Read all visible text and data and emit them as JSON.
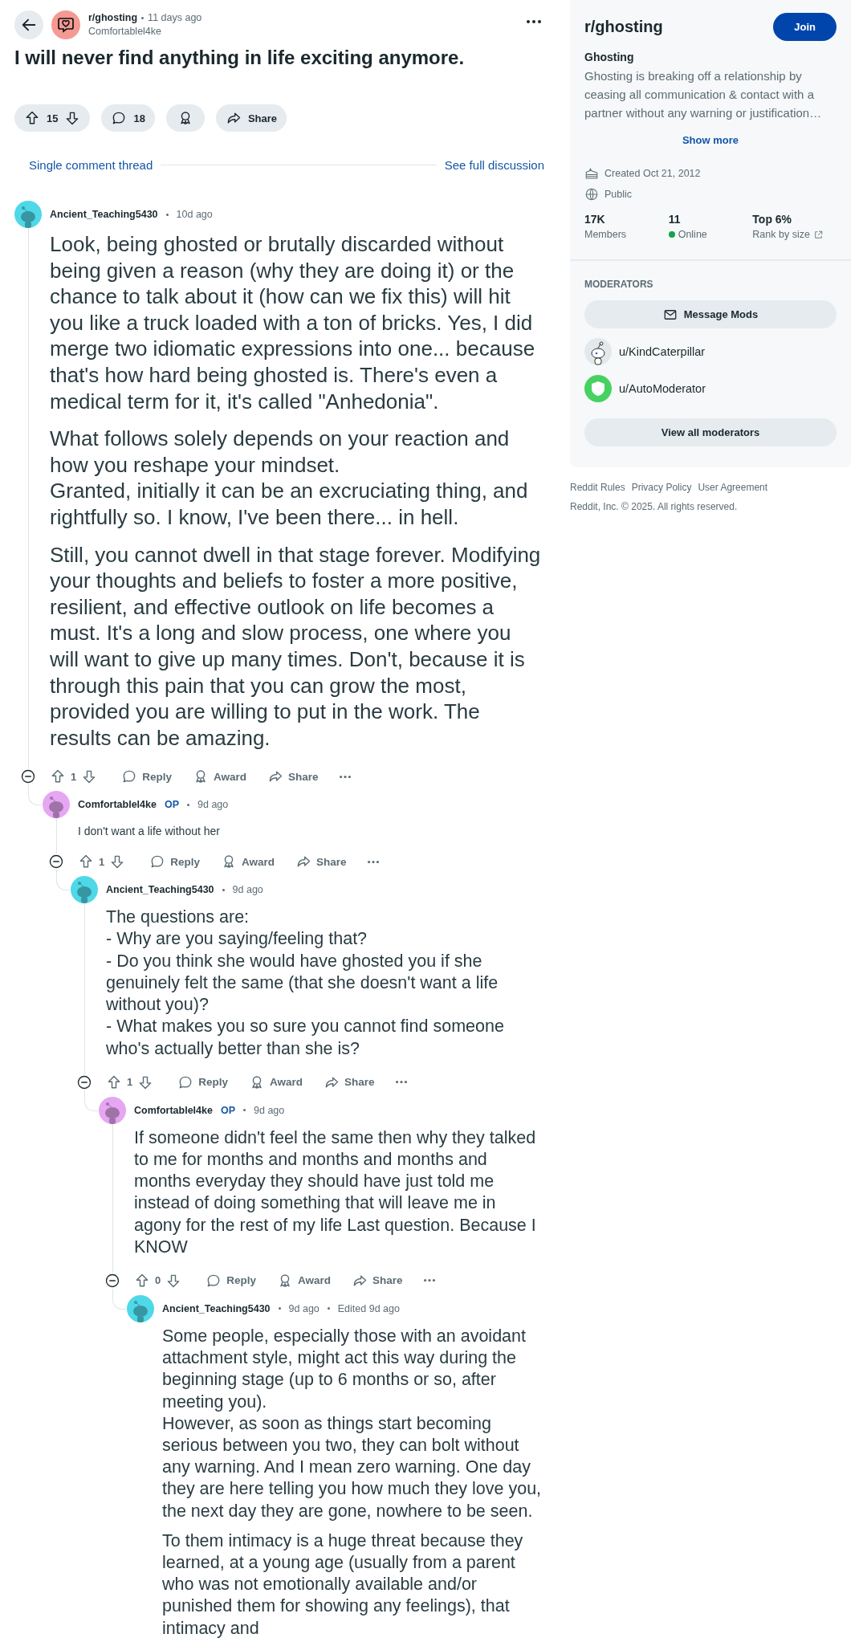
{
  "post": {
    "subreddit": "r/ghosting",
    "time": "11 days ago",
    "author": "Comfortablel4ke",
    "title": "I will never find anything in life exciting anymore.",
    "votes": "15",
    "comments": "18",
    "share": "Share"
  },
  "thread_nav": {
    "current": "Single comment thread",
    "full": "See full discussion"
  },
  "comments": [
    {
      "author": "Ancient_Teaching5430",
      "time": "10d ago",
      "color": "#4fd8e8",
      "kind": "large",
      "paragraphs": [
        "Look, being ghosted or brutally discarded without being given a reason (why they are doing it) or the chance to talk about it (how can we fix this) will hit you like a truck loaded with a ton of bricks. Yes, I did merge two idiomatic expressions into one... because that's how hard being ghosted is. There's even a medical term for it, it's called \"Anhedonia\".",
        "What follows solely depends on your reaction and how you reshape your mindset.\nGranted, initially it can be an excruciating thing, and rightfully so. I know, I've been there... in hell.",
        "Still, you cannot dwell in that stage forever. Modifying your thoughts and beliefs to foster a more positive, resilient, and effective outlook on life becomes a must. It's a long and slow process, one where you will want to give up many times. Don't, because it is through this pain that you can grow the most, provided you are willing to put in the work. The results can be amazing."
      ],
      "actions": {
        "votes": "1",
        "reply": "Reply",
        "award": "Award",
        "share": "Share"
      },
      "children": [
        {
          "author": "Comfortablel4ke",
          "op_label": "OP",
          "time": "9d ago",
          "color": "#e6a6f2",
          "kind": "small",
          "paragraphs": [
            "I don't want a life without her"
          ],
          "actions": {
            "votes": "1",
            "reply": "Reply",
            "award": "Award",
            "share": "Share"
          },
          "children": [
            {
              "author": "Ancient_Teaching5430",
              "time": "9d ago",
              "color": "#4fd8e8",
              "kind": "medium",
              "paragraphs": [
                "The questions are:\n- Why are you saying/feeling that?\n- Do you think she would have ghosted you if she genuinely felt the same (that she doesn't want a life without you)?\n- What makes you so sure you cannot find someone who's actually better than she is?"
              ],
              "actions": {
                "votes": "1",
                "reply": "Reply",
                "award": "Award",
                "share": "Share"
              },
              "children": [
                {
                  "author": "Comfortablel4ke",
                  "op_label": "OP",
                  "time": "9d ago",
                  "color": "#e6a6f2",
                  "kind": "medium",
                  "paragraphs": [
                    "If someone didn't feel the same then why they talked to me for months and months and months and months everyday they should have just told me instead of doing something that will leave me in agony for the rest of my life Last question. Because I KNOW"
                  ],
                  "actions": {
                    "votes": "0",
                    "reply": "Reply",
                    "award": "Award",
                    "share": "Share"
                  },
                  "children": [
                    {
                      "author": "Ancient_Teaching5430",
                      "time": "9d ago",
                      "edited": "Edited 9d ago",
                      "color": "#4fd8e8",
                      "kind": "medium",
                      "paragraphs": [
                        "Some people, especially those with an avoidant attachment style, might act this way during the beginning stage (up to 6 months or so, after meeting you).\nHowever, as soon as things start becoming serious between you two, they can bolt without any warning. And I mean zero warning. One day they are here telling you how much they love you, the next day they are gone, nowhere to be seen.",
                        "To them intimacy is a huge threat because they learned, at a young age (usually from a parent who was not emotionally available and/or punished them for showing any feelings), that intimacy and"
                      ]
                    }
                  ]
                }
              ]
            }
          ]
        }
      ]
    }
  ],
  "sidebar": {
    "name": "r/ghosting",
    "join": "Join",
    "title": "Ghosting",
    "description": "Ghosting is breaking off a relationship by ceasing all communication & contact with a partner without any warning or justification…",
    "show_more": "Show more",
    "created": "Created Oct 21, 2012",
    "visibility": "Public",
    "stats": [
      {
        "kind": "count",
        "value": "17K",
        "label": "Members"
      },
      {
        "kind": "online",
        "value": "11",
        "label": "Online"
      },
      {
        "kind": "rank",
        "value": "Top 6%",
        "label": "Rank by size"
      }
    ],
    "moderators_heading": "MODERATORS",
    "message_mods": "Message Mods",
    "moderators": [
      {
        "kind": "user",
        "name": "u/KindCaterpillar"
      },
      {
        "kind": "bot",
        "name": "u/AutoModerator"
      }
    ],
    "view_all": "View all moderators"
  },
  "footer": {
    "links": [
      "Reddit Rules",
      "Privacy Policy",
      "User Agreement"
    ],
    "copyright": "Reddit, Inc. © 2025. All rights reserved."
  }
}
